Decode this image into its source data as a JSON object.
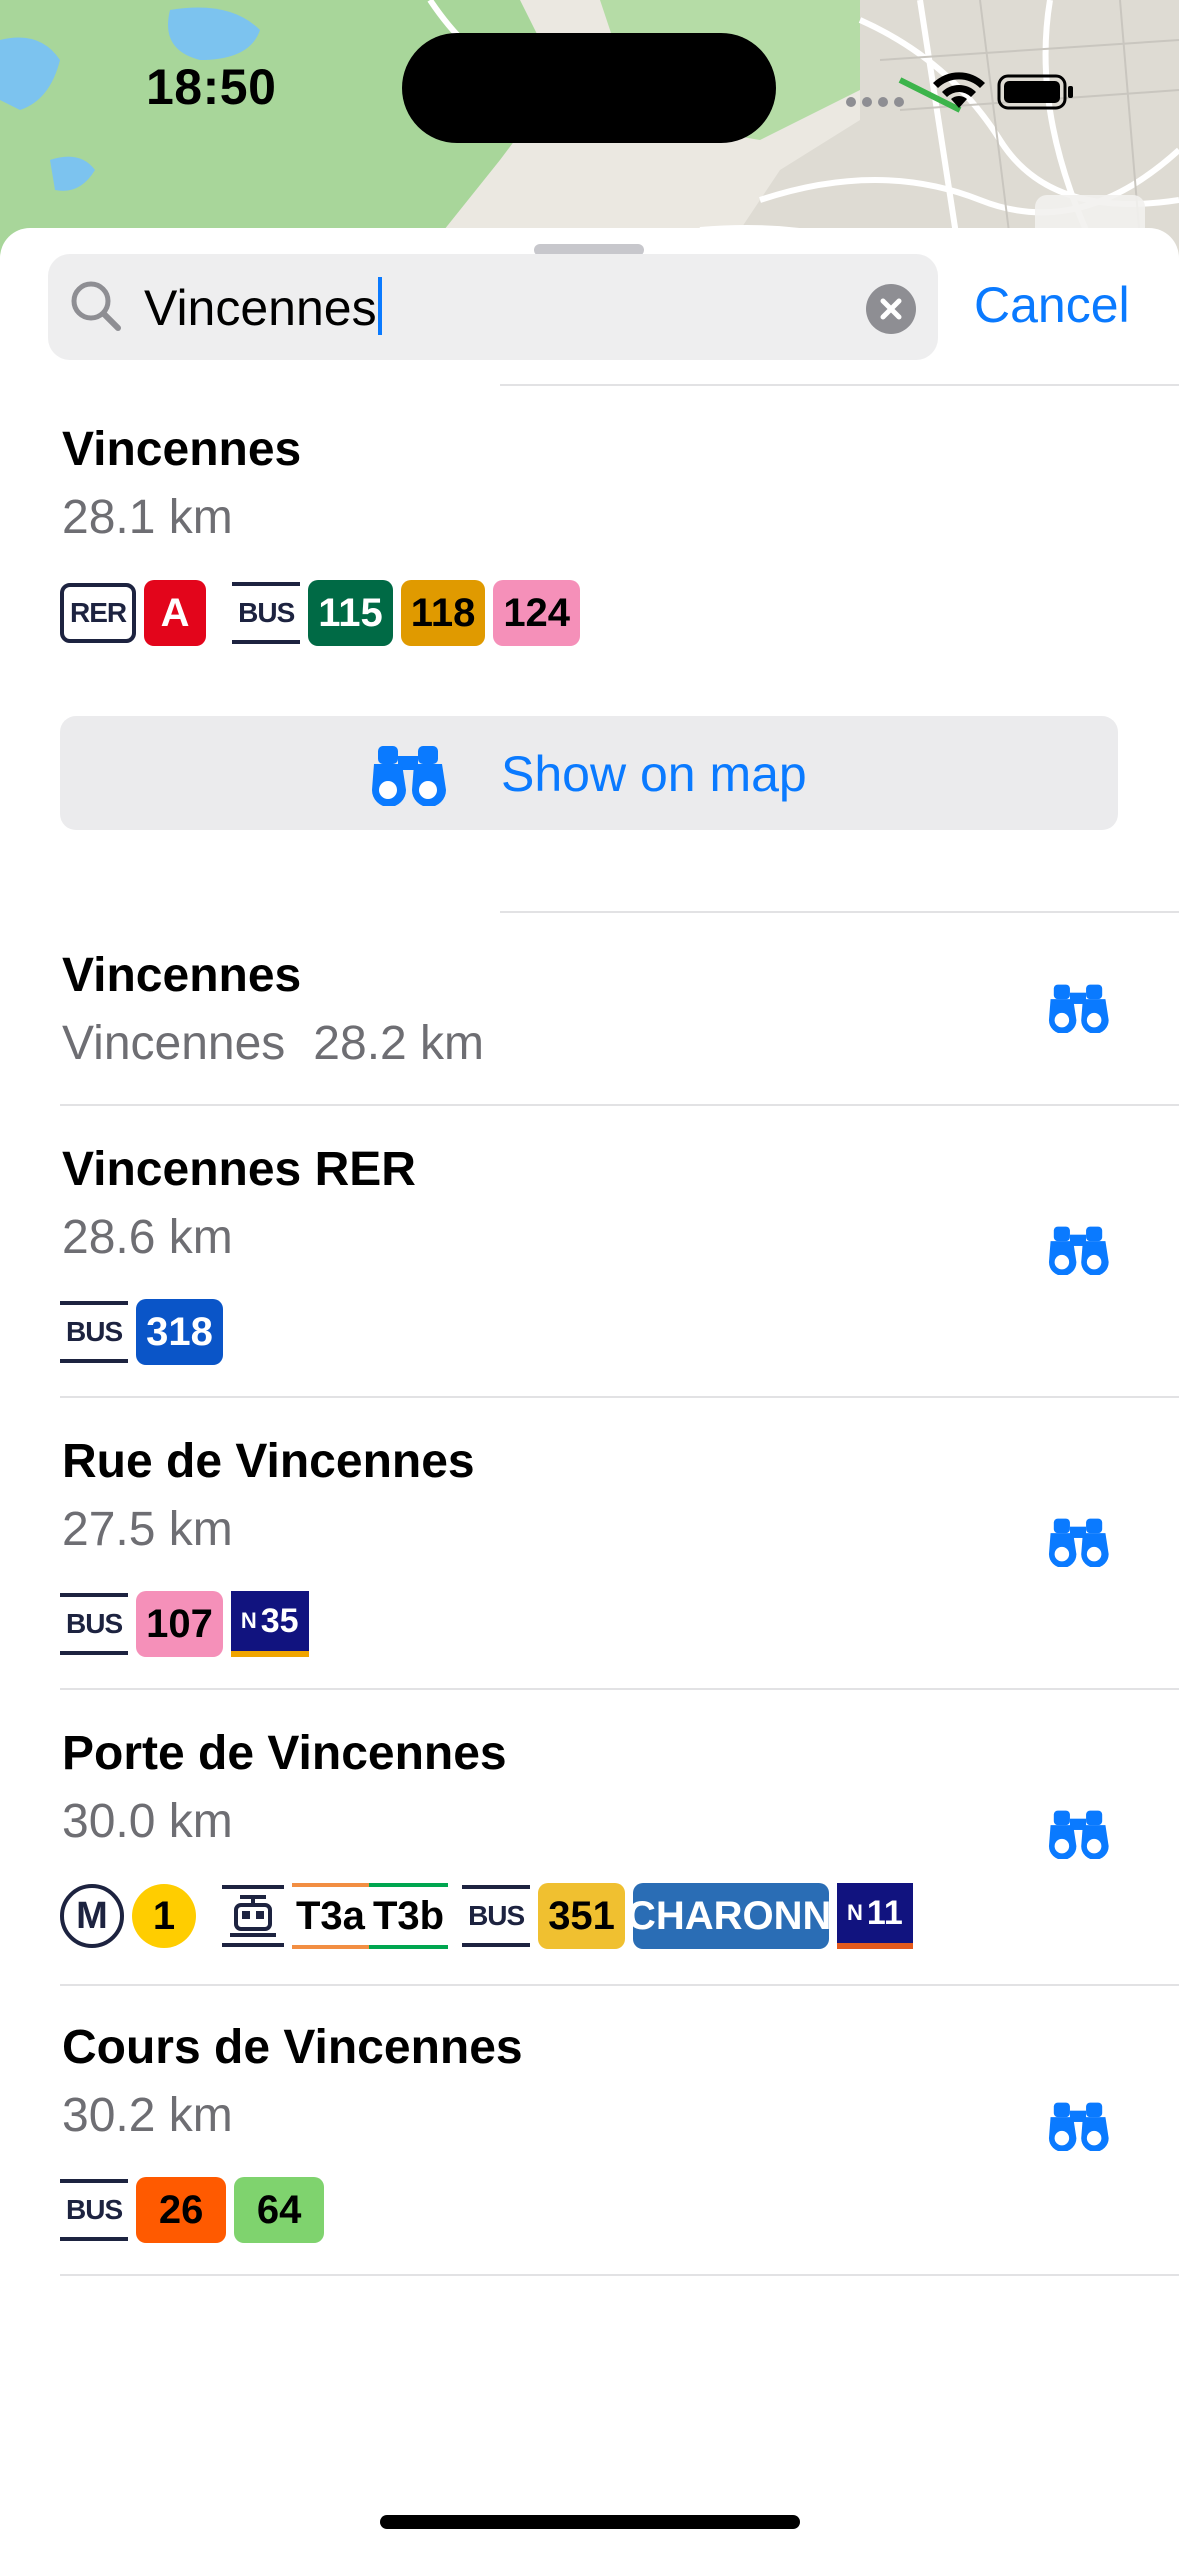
{
  "status": {
    "time": "18:50"
  },
  "search": {
    "value": "Vincennes",
    "cancel_label": "Cancel"
  },
  "results": [
    {
      "title": "Vincennes",
      "subtitle": "28.1 km",
      "action_label": "Show on map",
      "badges": [
        {
          "kind": "mode",
          "text": "RER"
        },
        {
          "kind": "line",
          "text": "A",
          "bg": "#e3051b",
          "fg": "#ffffff"
        },
        {
          "kind": "bus",
          "text": "BUS"
        },
        {
          "kind": "line",
          "text": "115",
          "bg": "#006a45",
          "fg": "#ffffff"
        },
        {
          "kind": "line",
          "text": "118",
          "bg": "#e09a00",
          "fg": "#000000"
        },
        {
          "kind": "line",
          "text": "124",
          "bg": "#f590b9",
          "fg": "#000000"
        }
      ]
    },
    {
      "title": "Vincennes",
      "subtitle_place": "Vincennes",
      "subtitle": "28.2 km"
    },
    {
      "title": "Vincennes RER",
      "subtitle": "28.6 km",
      "badges": [
        {
          "kind": "bus",
          "text": "BUS"
        },
        {
          "kind": "line",
          "text": "318",
          "bg": "#0a55c8",
          "fg": "#ffffff"
        }
      ]
    },
    {
      "title": "Rue de Vincennes",
      "subtitle": "27.5 km",
      "badges": [
        {
          "kind": "bus",
          "text": "BUS"
        },
        {
          "kind": "line",
          "text": "107",
          "bg": "#f590b9",
          "fg": "#000000"
        },
        {
          "kind": "noct",
          "text": "35",
          "bg": "#11137f",
          "fg": "#ffffff",
          "stripe": "#f0a500"
        }
      ]
    },
    {
      "title": "Porte de Vincennes",
      "subtitle": "30.0 km",
      "badges": [
        {
          "kind": "metro",
          "text": "M"
        },
        {
          "kind": "metro-line",
          "text": "1",
          "bg": "#ffcd00",
          "fg": "#000000"
        },
        {
          "kind": "tram",
          "text": "tram"
        },
        {
          "kind": "tramline",
          "text": "T3a",
          "stripe": "#f28e42"
        },
        {
          "kind": "tramline",
          "text": "T3b",
          "stripe": "#00a650"
        },
        {
          "kind": "bus",
          "text": "BUS"
        },
        {
          "kind": "line",
          "text": "351",
          "bg": "#f0c030",
          "fg": "#000000"
        },
        {
          "kind": "line",
          "text": "CHARONNE",
          "bg": "#2a6db5",
          "fg": "#ffffff"
        },
        {
          "kind": "noct",
          "text": "11",
          "bg": "#11137f",
          "fg": "#ffffff",
          "stripe": "#e55a1c"
        }
      ]
    },
    {
      "title": "Cours de Vincennes",
      "subtitle": "30.2 km",
      "badges": [
        {
          "kind": "bus",
          "text": "BUS"
        },
        {
          "kind": "line",
          "text": "26",
          "bg": "#ff5a00",
          "fg": "#000000"
        },
        {
          "kind": "line",
          "text": "64",
          "bg": "#7fd36e",
          "fg": "#000000"
        }
      ]
    }
  ]
}
